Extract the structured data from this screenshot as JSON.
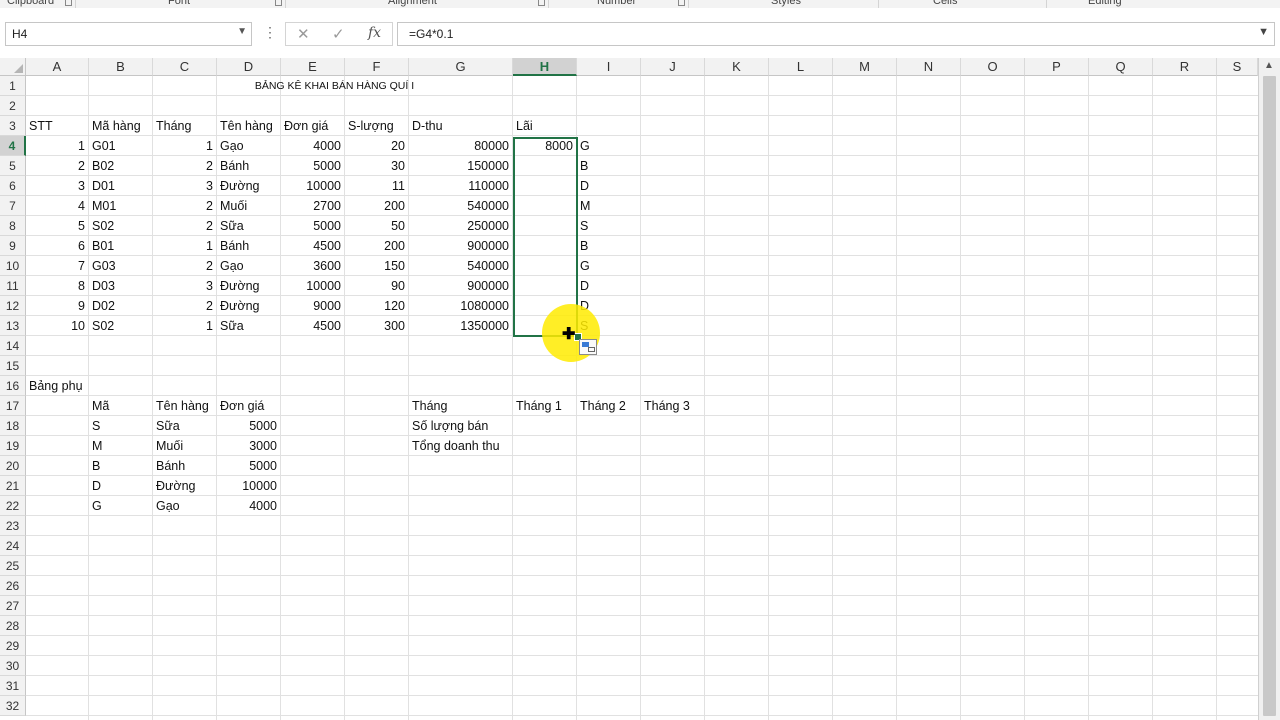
{
  "ribbon": {
    "groups": [
      "Clipboard",
      "Font",
      "Alignment",
      "Number",
      "Styles",
      "Cells",
      "Editing"
    ]
  },
  "formula_bar": {
    "name_box": "H4",
    "cancel_icon": "✕",
    "enter_icon": "✓",
    "fx_label": "fx",
    "formula": "=G4*0.1"
  },
  "columns": [
    "A",
    "B",
    "C",
    "D",
    "E",
    "F",
    "G",
    "H",
    "I",
    "J",
    "K",
    "L",
    "M",
    "N",
    "O",
    "P",
    "Q",
    "R",
    "S"
  ],
  "selected_column": "H",
  "selected_row": 4,
  "rows": [
    "1",
    "2",
    "3",
    "4",
    "5",
    "6",
    "7",
    "8",
    "9",
    "10",
    "11",
    "12",
    "13",
    "14",
    "15",
    "16",
    "17",
    "18",
    "19",
    "20",
    "21",
    "22",
    "23",
    "24",
    "25",
    "26",
    "27",
    "28",
    "29",
    "30",
    "31",
    "32"
  ],
  "sheet": {
    "title": "BẢNG KÊ KHAI BÁN HÀNG QUÍ I",
    "headers": [
      "STT",
      "Mã hàng",
      "Tháng",
      "Tên hàng",
      "Đơn giá",
      "S-lượng",
      "D-thu",
      "Lãi"
    ],
    "records": [
      {
        "stt": "1",
        "ma": "G01",
        "thang": "1",
        "ten": "Gạo",
        "gia": "4000",
        "sl": "20",
        "dthu": "80000",
        "lai": "8000",
        "i": "G"
      },
      {
        "stt": "2",
        "ma": "B02",
        "thang": "2",
        "ten": "Bánh",
        "gia": "5000",
        "sl": "30",
        "dthu": "150000",
        "lai": "",
        "i": "B"
      },
      {
        "stt": "3",
        "ma": "D01",
        "thang": "3",
        "ten": "Đường",
        "gia": "10000",
        "sl": "11",
        "dthu": "110000",
        "lai": "",
        "i": "D"
      },
      {
        "stt": "4",
        "ma": "M01",
        "thang": "2",
        "ten": "Muối",
        "gia": "2700",
        "sl": "200",
        "dthu": "540000",
        "lai": "",
        "i": "M"
      },
      {
        "stt": "5",
        "ma": "S02",
        "thang": "2",
        "ten": "Sữa",
        "gia": "5000",
        "sl": "50",
        "dthu": "250000",
        "lai": "",
        "i": "S"
      },
      {
        "stt": "6",
        "ma": "B01",
        "thang": "1",
        "ten": "Bánh",
        "gia": "4500",
        "sl": "200",
        "dthu": "900000",
        "lai": "",
        "i": "B"
      },
      {
        "stt": "7",
        "ma": "G03",
        "thang": "2",
        "ten": "Gạo",
        "gia": "3600",
        "sl": "150",
        "dthu": "540000",
        "lai": "",
        "i": "G"
      },
      {
        "stt": "8",
        "ma": "D03",
        "thang": "3",
        "ten": "Đường",
        "gia": "10000",
        "sl": "90",
        "dthu": "900000",
        "lai": "",
        "i": "D"
      },
      {
        "stt": "9",
        "ma": "D02",
        "thang": "2",
        "ten": "Đường",
        "gia": "9000",
        "sl": "120",
        "dthu": "1080000",
        "lai": "",
        "i": "D"
      },
      {
        "stt": "10",
        "ma": "S02",
        "thang": "1",
        "ten": "Sữa",
        "gia": "4500",
        "sl": "300",
        "dthu": "1350000",
        "lai": "",
        "i": "S"
      }
    ],
    "aux_title": "Bảng phụ",
    "aux_headers": [
      "Mã",
      "Tên hàng",
      "Đơn giá"
    ],
    "aux_rows": [
      {
        "ma": "S",
        "ten": "Sữa",
        "gia": "5000"
      },
      {
        "ma": "M",
        "ten": "Muối",
        "gia": "3000"
      },
      {
        "ma": "B",
        "ten": "Bánh",
        "gia": "5000"
      },
      {
        "ma": "D",
        "ten": "Đường",
        "gia": "10000"
      },
      {
        "ma": "G",
        "ten": "Gạo",
        "gia": "4000"
      }
    ],
    "summary_headers": [
      "Tháng",
      "Tháng 1",
      "Tháng 2",
      "Tháng 3"
    ],
    "summary_rows": [
      "Số lượng bán",
      "Tổng doanh thu"
    ]
  }
}
